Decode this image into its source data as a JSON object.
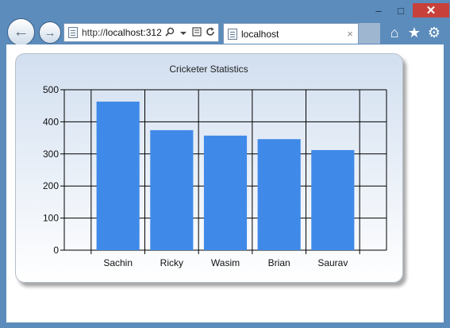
{
  "window": {
    "minimize_label": "–",
    "maximize_label": "□",
    "close_label": "✕"
  },
  "nav": {
    "back_icon": "←",
    "forward_icon": "→"
  },
  "address_bar": {
    "url_prefix": "http://",
    "url_host": "localhost:312",
    "search_icon": "search-icon",
    "dropdown_icon": "chevron-down-icon",
    "compat_icon": "compat-view-icon",
    "refresh_icon": "refresh-icon"
  },
  "tab": {
    "title": "localhost",
    "close_label": "×"
  },
  "toolbar": {
    "home_icon": "⌂",
    "favorites_icon": "★",
    "settings_icon": "⚙"
  },
  "colors": {
    "bar": "#3f8ae8",
    "chrome": "#5b8cbb"
  },
  "chart_data": {
    "type": "bar",
    "title": "Cricketer Statistics",
    "categories": [
      "Sachin",
      "Ricky",
      "Wasim",
      "Brian",
      "Saurav"
    ],
    "values": [
      463,
      374,
      357,
      346,
      312
    ],
    "ylim": [
      0,
      500
    ],
    "yticks": [
      0,
      100,
      200,
      300,
      400,
      500
    ],
    "xlabel": "",
    "ylabel": "",
    "grid": true
  }
}
